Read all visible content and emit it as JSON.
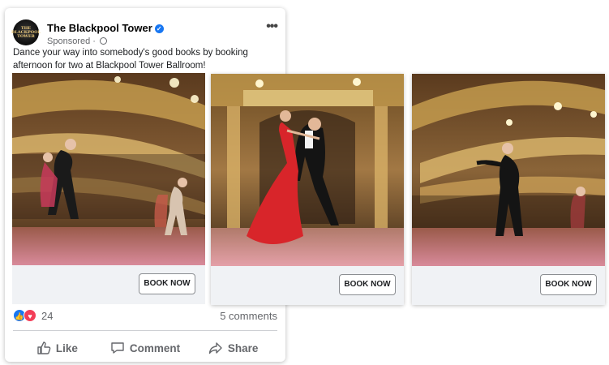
{
  "post": {
    "page_name": "The Blackpool Tower",
    "verified_icon": "check-badge-icon",
    "sponsored": "Sponsored",
    "avatar_text": "THE BLACKPOOL TOWER",
    "more_icon": "•••",
    "caption": "Dance your way into somebody's good books by booking afternoon for two at Blackpool Tower Ballroom!"
  },
  "carousel": [
    {
      "image": "ballroom-dancers-photo",
      "cta": "BOOK NOW"
    },
    {
      "image": "ballroom-couple-red-dress-photo",
      "cta": "BOOK NOW"
    },
    {
      "image": "ballroom-balcony-dancers-photo",
      "cta": "BOOK NOW"
    }
  ],
  "reactions": {
    "count": "24",
    "comments": "5 comments"
  },
  "actions": {
    "like": "Like",
    "comment": "Comment",
    "share": "Share"
  },
  "colors": {
    "facebook_blue": "#1877f2",
    "love_red": "#f33e58",
    "gold": "#c9a050"
  }
}
